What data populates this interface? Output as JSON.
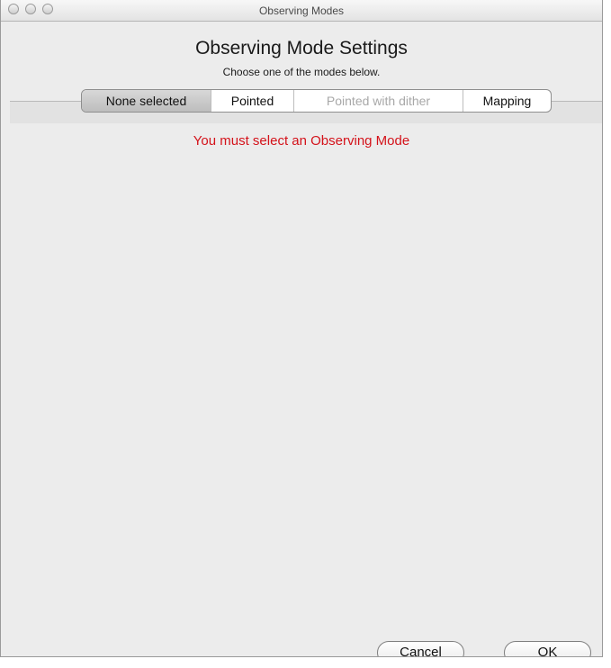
{
  "window": {
    "title": "Observing Modes"
  },
  "header": {
    "title": "Observing Mode Settings",
    "subtitle": "Choose one of the modes below."
  },
  "tabs": [
    {
      "label": "None selected",
      "selected": true,
      "enabled": true
    },
    {
      "label": "Pointed",
      "selected": false,
      "enabled": true
    },
    {
      "label": "Pointed with dither",
      "selected": false,
      "enabled": false
    },
    {
      "label": "Mapping",
      "selected": false,
      "enabled": true
    }
  ],
  "content": {
    "error_message": "You must select an Observing Mode",
    "error_color": "#d4121a"
  },
  "footer": {
    "cancel_label": "Cancel",
    "ok_label": "OK"
  }
}
